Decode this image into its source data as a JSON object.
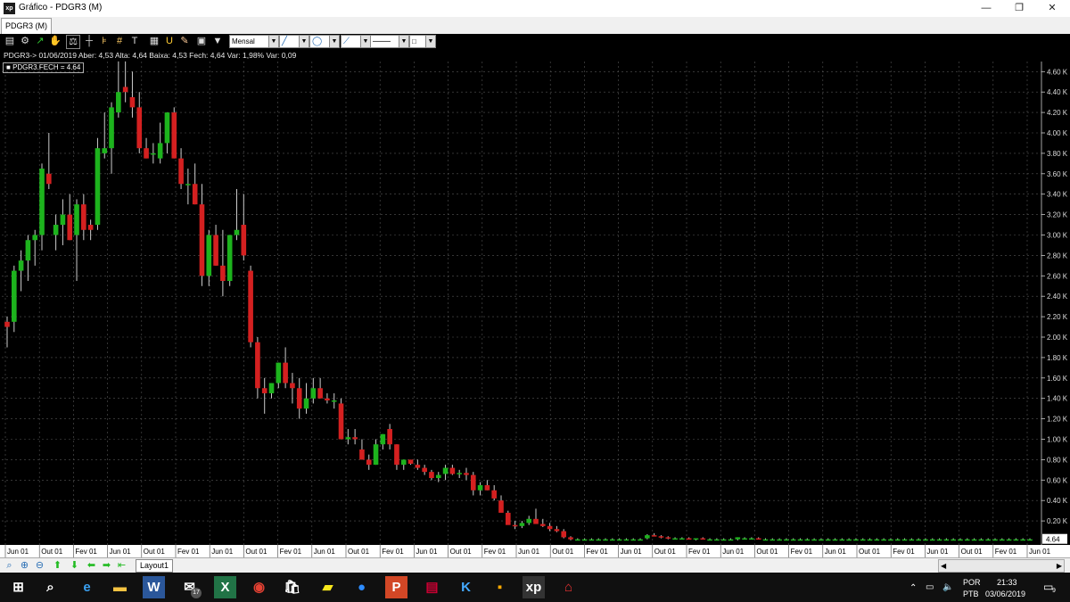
{
  "window": {
    "title": "Gráfico - PDGR3 (M)",
    "tab": "PDGR3 (M)",
    "minimize": "—",
    "maximize": "❐",
    "close": "✕"
  },
  "toolbar": {
    "period_select": "Mensal",
    "icons": [
      "chart-icon",
      "gear-icon",
      "trend-icon",
      "hand-icon",
      "balance-icon",
      "crosshair-icon",
      "fibonacci-icon",
      "grid-icon",
      "text-icon",
      "calculator-icon",
      "magnet-icon",
      "eraser-icon",
      "briefcase-icon",
      "filter-icon"
    ],
    "line_color": "#2a6fb5"
  },
  "info": {
    "line": "PDGR3-> 01/06/2019 Aber: 4,53 Alta: 4,64 Baixa: 4,53 Fech: 4,64 Var: 1,98% Var: 0,09",
    "legend": "PDGR3.FECH = 4.64",
    "last_price_tag": "4.64"
  },
  "chart_data": {
    "type": "candlestick",
    "up_color": "#1db31d",
    "down_color": "#d42020",
    "y_ticks": [
      "0.20 K",
      "0.40 K",
      "0.60 K",
      "0.80 K",
      "1.00 K",
      "1.20 K",
      "1.40 K",
      "1.60 K",
      "1.80 K",
      "2.00 K",
      "2.20 K",
      "2.40 K",
      "2.60 K",
      "2.80 K",
      "3.00 K",
      "3.20 K",
      "3.40 K",
      "3.60 K",
      "3.80 K",
      "4.00 K",
      "4.20 K",
      "4.40 K",
      "4.60 K"
    ],
    "x_ticks": [
      "Jun 01",
      "Out 01",
      "Fev 01",
      "Jun 01",
      "Out 01",
      "Fev 01",
      "Jun 01",
      "Out 01",
      "Fev 01",
      "Jun 01",
      "Out 01",
      "Fev 01",
      "Jun 01",
      "Out 01",
      "Fev 01",
      "Jun 01",
      "Out 01",
      "Fev 01",
      "Jun 01",
      "Out 01",
      "Fev 01",
      "Jun 01",
      "Out 01",
      "Fev 01",
      "Jun 01",
      "Out 01",
      "Fev 01",
      "Jun 01",
      "Out 01",
      "Fev 01",
      "Jun 01"
    ],
    "ohlc": [
      [
        2.15,
        2.2,
        1.9,
        2.1
      ],
      [
        2.15,
        2.7,
        2.05,
        2.65
      ],
      [
        2.65,
        2.85,
        2.45,
        2.75
      ],
      [
        2.75,
        3.0,
        2.55,
        2.95
      ],
      [
        2.95,
        3.05,
        2.7,
        3.0
      ],
      [
        3.0,
        3.7,
        2.85,
        3.65
      ],
      [
        3.6,
        4.0,
        3.45,
        3.5
      ],
      [
        3.0,
        3.2,
        2.85,
        3.1
      ],
      [
        3.1,
        3.35,
        2.9,
        3.2
      ],
      [
        3.2,
        3.4,
        2.95,
        2.95
      ],
      [
        3.0,
        3.35,
        2.55,
        3.3
      ],
      [
        3.3,
        3.4,
        2.95,
        3.05
      ],
      [
        3.1,
        3.15,
        2.95,
        3.05
      ],
      [
        3.1,
        3.95,
        3.05,
        3.85
      ],
      [
        3.8,
        4.2,
        3.75,
        3.85
      ],
      [
        3.85,
        4.3,
        3.6,
        4.25
      ],
      [
        4.2,
        4.7,
        4.15,
        4.4
      ],
      [
        4.45,
        4.7,
        4.3,
        4.4
      ],
      [
        4.35,
        4.6,
        4.15,
        4.25
      ],
      [
        4.25,
        4.4,
        3.8,
        3.85
      ],
      [
        3.85,
        3.95,
        3.75,
        3.75
      ],
      [
        3.8,
        3.9,
        3.7,
        3.8
      ],
      [
        3.75,
        4.1,
        3.7,
        3.9
      ],
      [
        3.9,
        4.2,
        3.8,
        4.2
      ],
      [
        4.2,
        4.25,
        3.75,
        3.75
      ],
      [
        3.75,
        3.85,
        3.45,
        3.5
      ],
      [
        3.5,
        3.65,
        3.3,
        3.5
      ],
      [
        3.5,
        3.7,
        3.3,
        3.3
      ],
      [
        3.3,
        3.5,
        2.5,
        2.6
      ],
      [
        2.6,
        3.05,
        2.5,
        3.0
      ],
      [
        3.0,
        3.1,
        2.7,
        2.7
      ],
      [
        2.7,
        3.05,
        2.4,
        2.55
      ],
      [
        2.55,
        3.0,
        2.5,
        3.0
      ],
      [
        3.0,
        3.45,
        2.95,
        3.05
      ],
      [
        3.1,
        3.4,
        2.75,
        2.8
      ],
      [
        2.65,
        2.7,
        1.9,
        1.95
      ],
      [
        1.95,
        2.0,
        1.4,
        1.5
      ],
      [
        1.5,
        1.6,
        1.25,
        1.45
      ],
      [
        1.45,
        1.55,
        1.4,
        1.55
      ],
      [
        1.55,
        1.75,
        1.5,
        1.75
      ],
      [
        1.75,
        1.9,
        1.5,
        1.55
      ],
      [
        1.55,
        1.65,
        1.35,
        1.5
      ],
      [
        1.5,
        1.6,
        1.2,
        1.3
      ],
      [
        1.3,
        1.55,
        1.25,
        1.4
      ],
      [
        1.4,
        1.6,
        1.35,
        1.5
      ],
      [
        1.5,
        1.6,
        1.4,
        1.4
      ],
      [
        1.4,
        1.45,
        1.35,
        1.38
      ],
      [
        1.38,
        1.45,
        1.3,
        1.38
      ],
      [
        1.35,
        1.4,
        1.0,
        1.0
      ],
      [
        1.0,
        1.1,
        0.95,
        1.02
      ],
      [
        1.02,
        1.1,
        0.95,
        1.0
      ],
      [
        0.9,
        1.0,
        0.8,
        0.8
      ],
      [
        0.8,
        0.85,
        0.7,
        0.75
      ],
      [
        0.75,
        1.0,
        0.75,
        0.95
      ],
      [
        0.95,
        1.05,
        0.9,
        1.05
      ],
      [
        1.1,
        1.15,
        0.9,
        0.95
      ],
      [
        0.95,
        0.95,
        0.7,
        0.75
      ],
      [
        0.75,
        0.8,
        0.7,
        0.8
      ],
      [
        0.8,
        0.8,
        0.75,
        0.76
      ],
      [
        0.75,
        0.8,
        0.7,
        0.72
      ],
      [
        0.72,
        0.75,
        0.65,
        0.68
      ],
      [
        0.68,
        0.7,
        0.6,
        0.62
      ],
      [
        0.62,
        0.68,
        0.58,
        0.65
      ],
      [
        0.66,
        0.75,
        0.6,
        0.72
      ],
      [
        0.72,
        0.75,
        0.65,
        0.66
      ],
      [
        0.66,
        0.7,
        0.62,
        0.67
      ],
      [
        0.67,
        0.72,
        0.6,
        0.65
      ],
      [
        0.65,
        0.68,
        0.45,
        0.5
      ],
      [
        0.5,
        0.58,
        0.45,
        0.55
      ],
      [
        0.55,
        0.6,
        0.5,
        0.5
      ],
      [
        0.5,
        0.55,
        0.4,
        0.42
      ],
      [
        0.4,
        0.45,
        0.3,
        0.28
      ],
      [
        0.28,
        0.3,
        0.18,
        0.16
      ],
      [
        0.16,
        0.2,
        0.12,
        0.15
      ],
      [
        0.15,
        0.2,
        0.13,
        0.18
      ],
      [
        0.18,
        0.25,
        0.16,
        0.22
      ],
      [
        0.22,
        0.32,
        0.18,
        0.17
      ],
      [
        0.17,
        0.22,
        0.14,
        0.15
      ],
      [
        0.15,
        0.18,
        0.1,
        0.12
      ],
      [
        0.12,
        0.15,
        0.09,
        0.1
      ],
      [
        0.1,
        0.12,
        0.03,
        0.04
      ],
      [
        0.04,
        0.05,
        0.01,
        0.02
      ],
      [
        0.02,
        0.03,
        0.01,
        0.02
      ],
      [
        0.02,
        0.03,
        0.01,
        0.02
      ],
      [
        0.02,
        0.03,
        0.01,
        0.02
      ],
      [
        0.02,
        0.03,
        0.01,
        0.02
      ],
      [
        0.02,
        0.03,
        0.01,
        0.02
      ],
      [
        0.02,
        0.03,
        0.01,
        0.02
      ],
      [
        0.02,
        0.03,
        0.01,
        0.02
      ],
      [
        0.02,
        0.03,
        0.01,
        0.02
      ],
      [
        0.02,
        0.03,
        0.01,
        0.02
      ],
      [
        0.02,
        0.03,
        0.01,
        0.02
      ],
      [
        0.03,
        0.07,
        0.02,
        0.06
      ],
      [
        0.06,
        0.08,
        0.05,
        0.05
      ],
      [
        0.05,
        0.06,
        0.03,
        0.04
      ],
      [
        0.04,
        0.05,
        0.02,
        0.03
      ],
      [
        0.03,
        0.04,
        0.02,
        0.03
      ],
      [
        0.03,
        0.04,
        0.02,
        0.03
      ],
      [
        0.03,
        0.04,
        0.02,
        0.02
      ],
      [
        0.02,
        0.03,
        0.01,
        0.03
      ],
      [
        0.03,
        0.04,
        0.02,
        0.02
      ],
      [
        0.02,
        0.03,
        0.01,
        0.02
      ],
      [
        0.02,
        0.03,
        0.01,
        0.02
      ],
      [
        0.02,
        0.03,
        0.01,
        0.02
      ],
      [
        0.02,
        0.03,
        0.01,
        0.02
      ],
      [
        0.02,
        0.04,
        0.01,
        0.04
      ],
      [
        0.03,
        0.04,
        0.02,
        0.03
      ],
      [
        0.03,
        0.04,
        0.02,
        0.03
      ],
      [
        0.03,
        0.04,
        0.02,
        0.02
      ],
      [
        0.02,
        0.03,
        0.01,
        0.02
      ],
      [
        0.02,
        0.03,
        0.01,
        0.02
      ],
      [
        0.02,
        0.03,
        0.01,
        0.02
      ],
      [
        0.02,
        0.03,
        0.01,
        0.02
      ],
      [
        0.02,
        0.03,
        0.01,
        0.02
      ],
      [
        0.02,
        0.03,
        0.01,
        0.02
      ],
      [
        0.02,
        0.03,
        0.01,
        0.02
      ],
      [
        0.02,
        0.03,
        0.01,
        0.02
      ],
      [
        0.02,
        0.03,
        0.01,
        0.02
      ],
      [
        0.02,
        0.03,
        0.01,
        0.02
      ],
      [
        0.02,
        0.03,
        0.01,
        0.02
      ],
      [
        0.02,
        0.03,
        0.01,
        0.02
      ],
      [
        0.02,
        0.03,
        0.01,
        0.02
      ],
      [
        0.02,
        0.03,
        0.01,
        0.02
      ],
      [
        0.02,
        0.03,
        0.01,
        0.02
      ],
      [
        0.02,
        0.03,
        0.01,
        0.02
      ],
      [
        0.02,
        0.03,
        0.01,
        0.02
      ],
      [
        0.02,
        0.03,
        0.01,
        0.02
      ],
      [
        0.02,
        0.03,
        0.01,
        0.02
      ],
      [
        0.02,
        0.03,
        0.01,
        0.02
      ],
      [
        0.02,
        0.03,
        0.01,
        0.02
      ],
      [
        0.02,
        0.03,
        0.01,
        0.02
      ],
      [
        0.02,
        0.03,
        0.01,
        0.02
      ],
      [
        0.02,
        0.03,
        0.01,
        0.02
      ],
      [
        0.02,
        0.03,
        0.01,
        0.02
      ],
      [
        0.02,
        0.03,
        0.01,
        0.02
      ],
      [
        0.02,
        0.03,
        0.01,
        0.02
      ],
      [
        0.02,
        0.03,
        0.01,
        0.02
      ],
      [
        0.02,
        0.03,
        0.01,
        0.02
      ],
      [
        0.02,
        0.03,
        0.01,
        0.02
      ],
      [
        0.02,
        0.03,
        0.01,
        0.02
      ],
      [
        0.02,
        0.03,
        0.01,
        0.02
      ],
      [
        0.02,
        0.03,
        0.01,
        0.02
      ],
      [
        0.02,
        0.03,
        0.01,
        0.02
      ],
      [
        0.02,
        0.03,
        0.01,
        0.02
      ],
      [
        0.02,
        0.03,
        0.01,
        0.02
      ],
      [
        0.02,
        0.03,
        0.01,
        0.02
      ],
      [
        0.02,
        0.03,
        0.01,
        0.02
      ],
      [
        0.02,
        0.03,
        0.01,
        0.02
      ]
    ]
  },
  "nav": {
    "icons": [
      "zoom-icon",
      "zoom-in-icon",
      "zoom-out-icon",
      "arrow-up-icon",
      "arrow-down-icon",
      "arrow-left-icon",
      "arrow-right-icon",
      "arrow-end-icon"
    ],
    "layout_tab": "Layout1"
  },
  "taskbar": {
    "apps": [
      "windows-start-icon",
      "search-icon",
      "edge-icon",
      "file-explorer-icon",
      "word-icon",
      "mail-icon",
      "excel-icon",
      "chrome-icon",
      "store-icon",
      "sticky-notes-icon",
      "zoom-app-icon",
      "powerpoint-icon",
      "app-icon",
      "app-icon",
      "app-icon",
      "xp-icon",
      "pdf-icon"
    ],
    "mail_badge": "17",
    "lang": "POR",
    "lang_sub": "PTB",
    "time": "21:33",
    "date": "03/06/2019",
    "notify_count": "9"
  }
}
